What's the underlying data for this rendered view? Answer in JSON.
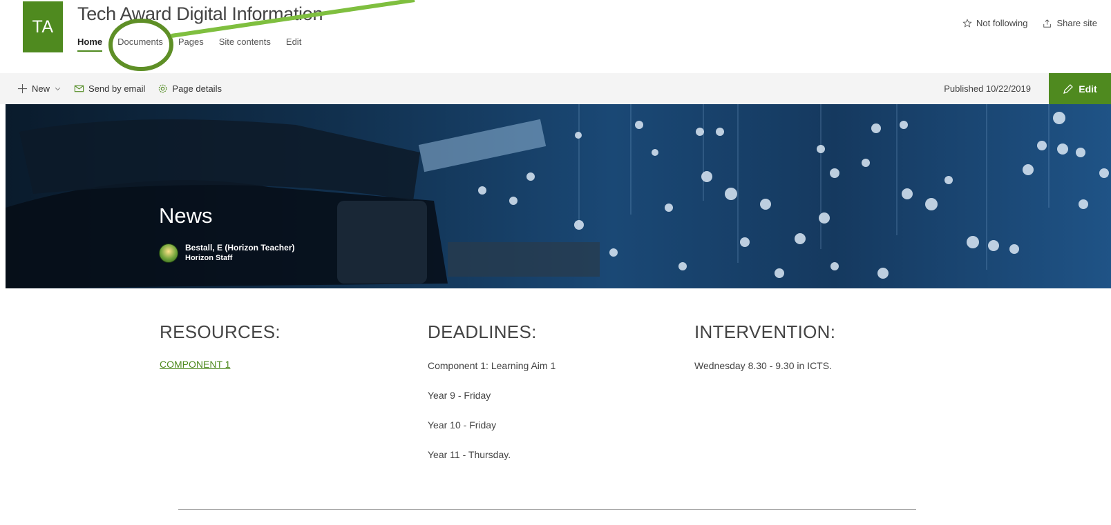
{
  "site": {
    "logo_initials": "TA",
    "title": "Tech Award Digital Information",
    "nav": [
      {
        "label": "Home",
        "active": true
      },
      {
        "label": "Documents",
        "active": false
      },
      {
        "label": "Pages",
        "active": false
      },
      {
        "label": "Site contents",
        "active": false
      },
      {
        "label": "Edit",
        "active": false
      }
    ],
    "follow_label": "Not following",
    "share_label": "Share site"
  },
  "command_bar": {
    "new_label": "New",
    "email_label": "Send by email",
    "details_label": "Page details",
    "published_text": "Published 10/22/2019",
    "edit_label": "Edit"
  },
  "hero": {
    "title": "News",
    "author_name": "Bestall, E (Horizon Teacher)",
    "author_group": "Horizon Staff"
  },
  "sections": {
    "resources": {
      "heading": "RESOURCES:",
      "link": "COMPONENT 1"
    },
    "deadlines": {
      "heading": "DEADLINES:",
      "items": [
        "Component 1: Learning Aim 1",
        "Year 9 - Friday",
        "Year 10 - Friday",
        "Year 11 - Thursday."
      ]
    },
    "intervention": {
      "heading": "INTERVENTION:",
      "text": "Wednesday 8.30 - 9.30 in ICTS."
    }
  },
  "colors": {
    "brand_green": "#4f8a1f",
    "annotation_green": "#7fbf3f"
  }
}
